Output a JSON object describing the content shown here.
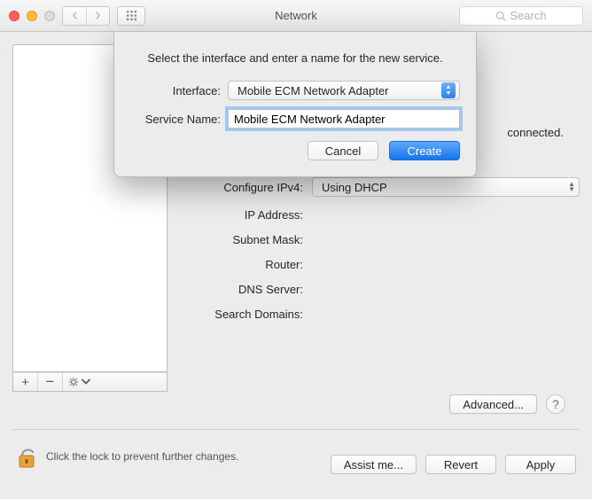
{
  "window": {
    "title": "Network"
  },
  "search": {
    "placeholder": "Search"
  },
  "status": {
    "text": "connected."
  },
  "form": {
    "configure_ipv4_label": "Configure IPv4:",
    "configure_ipv4_value": "Using DHCP",
    "ip_address_label": "IP Address:",
    "subnet_mask_label": "Subnet Mask:",
    "router_label": "Router:",
    "dns_server_label": "DNS Server:",
    "search_domains_label": "Search Domains:"
  },
  "buttons": {
    "advanced": "Advanced...",
    "assist": "Assist me...",
    "revert": "Revert",
    "apply": "Apply"
  },
  "lock": {
    "text": "Click the lock to prevent further changes."
  },
  "sheet": {
    "prompt": "Select the interface and enter a name for the new service.",
    "interface_label": "Interface:",
    "interface_value": "Mobile ECM Network Adapter",
    "service_name_label": "Service Name:",
    "service_name_value": "Mobile ECM Network Adapter",
    "cancel": "Cancel",
    "create": "Create"
  },
  "sidebar_footer": {
    "plus": "+",
    "minus": "−"
  }
}
